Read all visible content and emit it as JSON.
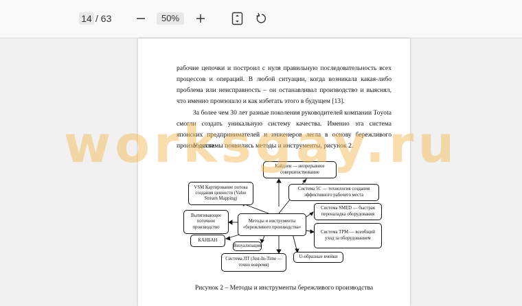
{
  "toolbar": {
    "current_page": "14",
    "page_separator": "/",
    "total_pages": "63",
    "zoom": "50%",
    "icons": [
      "minus-icon",
      "plus-icon",
      "fit-page-icon",
      "rotate-icon"
    ]
  },
  "document": {
    "paragraphs": [
      "рабочие цепочки и построил с нуля правильную последовательность всех процессов и операций. В любой ситуации, когда возникала какая-либо проблема или неисправность – он останавливал производство и выяснял, что именно произошло и как избегать этого в будущем [13].",
      "За более чем 30 лет разные поколения руководителей компании Toyota смогли создать уникальную систему качества. Именно эта система японских предпринимателей и инженеров легла в основу бережливого производства.",
      "У системы появились методы и инструменты, рисунок 2."
    ],
    "diagram": {
      "center": "Методы и инструменты «бережливого производства»",
      "nodes": [
        "Кайдзен — непрерывное совершенствование",
        "VSM Картирование потока создания ценности (Value Stream Mapping)",
        "Система 5С — технология создания эффективного рабочего места",
        "Система SMED — быстрая переналадка оборудования",
        "Вытягивающее поточное производство",
        "Система TPM — всеобщий уход за оборудованием",
        "КАНБАН",
        "Визуализация",
        "Система JIT (Just-In-Time — точно вовремя)",
        "U-образные ячейки"
      ]
    },
    "caption": "Рисунок 2 – Методы и инструменты бережливого производства"
  },
  "watermark": "worksgay.ru",
  "colors": {
    "watermark": "#f4bc5c",
    "toolbar_bg": "#f9f9f9",
    "viewer_bg": "#f1f1f1"
  }
}
